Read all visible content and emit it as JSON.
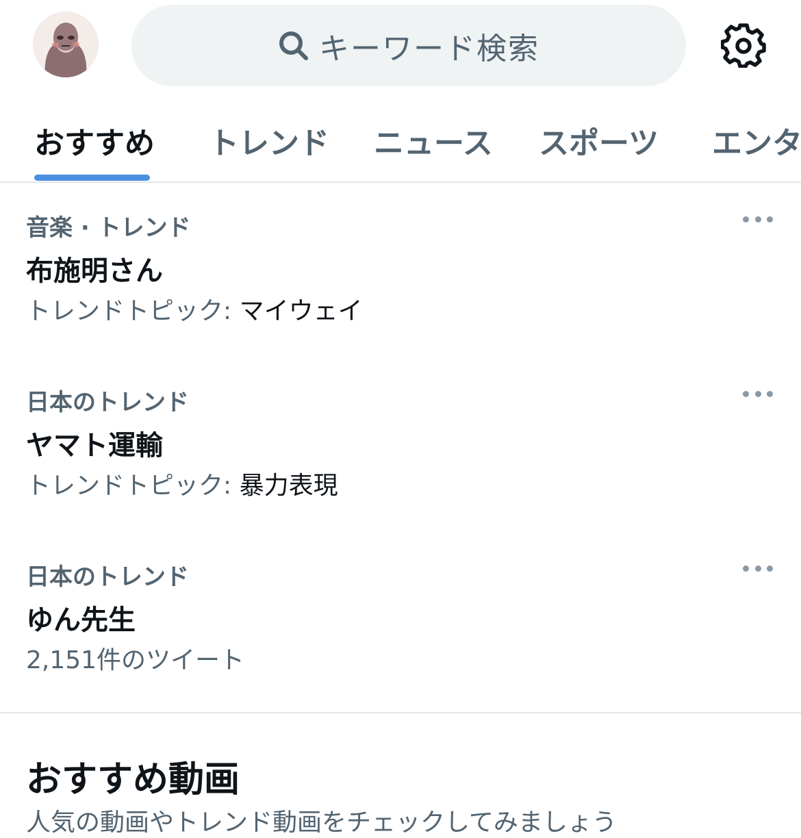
{
  "search": {
    "placeholder": "キーワード検索"
  },
  "tabs": [
    {
      "label": "おすすめ",
      "active": true
    },
    {
      "label": "トレンド",
      "active": false
    },
    {
      "label": "ニュース",
      "active": false
    },
    {
      "label": "スポーツ",
      "active": false
    },
    {
      "label": "エンタ",
      "active": false
    }
  ],
  "trends": [
    {
      "context": "音楽 · トレンド",
      "title": "布施明さん",
      "sub_prefix": "トレンドトピック: ",
      "sub_topic": "マイウェイ"
    },
    {
      "context": "日本のトレンド",
      "title": "ヤマト運輸",
      "sub_prefix": "トレンドトピック: ",
      "sub_topic": "暴力表現"
    },
    {
      "context": "日本のトレンド",
      "title": "ゆん先生",
      "sub_prefix": "2,151件のツイート",
      "sub_topic": ""
    }
  ],
  "videos_section": {
    "title": "おすすめ動画",
    "subtitle": "人気の動画やトレンド動画をチェックしてみましょう"
  },
  "colors": {
    "accent": "#4a90e2",
    "text_primary": "#0f1419",
    "text_secondary": "#536471",
    "search_bg": "#eff3f4"
  },
  "icons": {
    "avatar": "gorilla-avatar",
    "search": "search-icon",
    "settings": "gear-icon",
    "more": "more-horizontal-icon"
  }
}
